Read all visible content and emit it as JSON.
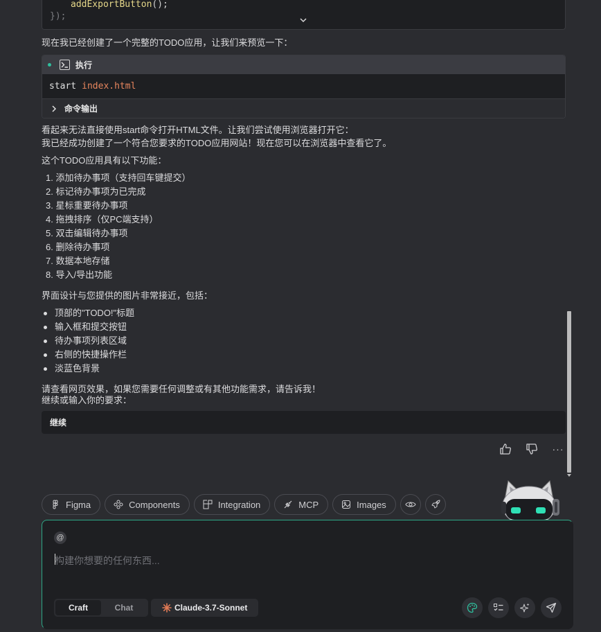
{
  "code_block": {
    "line1_call": "addExportButton",
    "line1_punct": "();",
    "line2": "});"
  },
  "intro_text": "现在我已经创建了一个完整的TODO应用，让我们来预览一下：",
  "exec": {
    "header_label": "执行",
    "command": "start",
    "argument": "index.html",
    "output_label": "命令输出"
  },
  "message": {
    "line1": "看起来无法直接使用start命令打开HTML文件。让我们尝试使用浏览器打开它：",
    "line2": "我已经成功创建了一个符合您要求的TODO应用网站！现在您可以在浏览器中查看它了。",
    "features_title": "这个TODO应用具有以下功能：",
    "features": [
      "1. 添加待办事项（支持回车键提交）",
      "2. 标记待办事项为已完成",
      "3. 星标重要待办事项",
      "4. 拖拽排序（仅PC端支持）",
      "5. 双击编辑待办事项",
      "6. 删除待办事项",
      "7. 数据本地存储",
      "8. 导入/导出功能"
    ],
    "design_title": "界面设计与您提供的图片非常接近，包括：",
    "design_points": [
      "顶部的\"TODO!\"标题",
      "输入框和提交按钮",
      "待办事项列表区域",
      "右侧的快捷操作栏",
      "淡蓝色背景"
    ],
    "closing1": "请查看网页效果，如果您需要任何调整或有其他功能需求，请告诉我！",
    "closing2": "继续或输入你的要求："
  },
  "continue_label": "继续",
  "more_label": "···",
  "chips": [
    {
      "label": "Figma",
      "icon": "figma-icon"
    },
    {
      "label": "Components",
      "icon": "components-icon"
    },
    {
      "label": "Integration",
      "icon": "integration-icon"
    },
    {
      "label": "MCP",
      "icon": "mcp-icon"
    },
    {
      "label": "Images",
      "icon": "image-icon"
    }
  ],
  "composer": {
    "at_symbol": "@",
    "placeholder": "构建你想要的任何东西...",
    "modes": [
      "Craft",
      "Chat"
    ],
    "active_mode": "Craft",
    "model": "Claude-3.7-Sonnet"
  },
  "colors": {
    "background": "#2b2c30",
    "panel": "#1e1f22",
    "accent": "#2fbf9d",
    "string": "#e8865e"
  }
}
